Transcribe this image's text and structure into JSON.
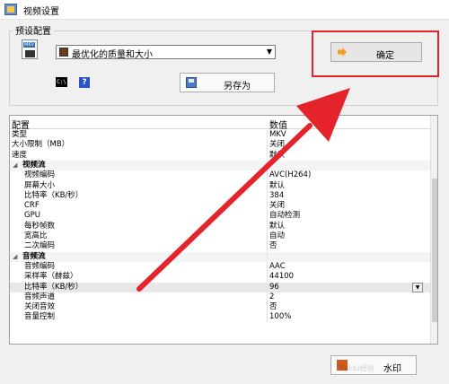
{
  "window": {
    "title": "视频设置"
  },
  "preset": {
    "group_label": "预设配置",
    "format_tag": "MKV",
    "selected": "最优化的质量和大小",
    "save_as_label": "另存为",
    "help_glyph": "?"
  },
  "ok_button": {
    "label": "确定"
  },
  "grid": {
    "header": {
      "name": "配置",
      "value": "数值"
    },
    "rows": [
      {
        "name": "类型",
        "value": "MKV",
        "kind": "plain"
      },
      {
        "name": "大小限制（MB）",
        "value": "关闭",
        "kind": "plain"
      },
      {
        "name": "速度",
        "value": "默认",
        "kind": "plain"
      },
      {
        "name": "视频流",
        "value": "",
        "kind": "category"
      },
      {
        "name": "视频编码",
        "value": "AVC(H264)",
        "kind": "child"
      },
      {
        "name": "屏幕大小",
        "value": "默认",
        "kind": "child"
      },
      {
        "name": "比特率（KB/秒）",
        "value": "384",
        "kind": "child"
      },
      {
        "name": "CRF",
        "value": "关闭",
        "kind": "child"
      },
      {
        "name": "GPU",
        "value": "自动检测",
        "kind": "child"
      },
      {
        "name": "每秒帧数",
        "value": "默认",
        "kind": "child"
      },
      {
        "name": "宽高比",
        "value": "自动",
        "kind": "child"
      },
      {
        "name": "二次编码",
        "value": "否",
        "kind": "child"
      },
      {
        "name": "音频流",
        "value": "",
        "kind": "category"
      },
      {
        "name": "音频编码",
        "value": "AAC",
        "kind": "child"
      },
      {
        "name": "采样率（赫兹）",
        "value": "44100",
        "kind": "child"
      },
      {
        "name": "比特率（KB/秒）",
        "value": "96",
        "kind": "child",
        "selected": true,
        "dropdown": true
      },
      {
        "name": "音频声道",
        "value": "2",
        "kind": "child"
      },
      {
        "name": "关闭音效",
        "value": "否",
        "kind": "child"
      },
      {
        "name": "音量控制",
        "value": "100%",
        "kind": "child"
      }
    ]
  },
  "bottom_button": {
    "label": "水印"
  },
  "watermark": "Baidu经验",
  "colors": {
    "annotation_red": "#e5232b"
  }
}
